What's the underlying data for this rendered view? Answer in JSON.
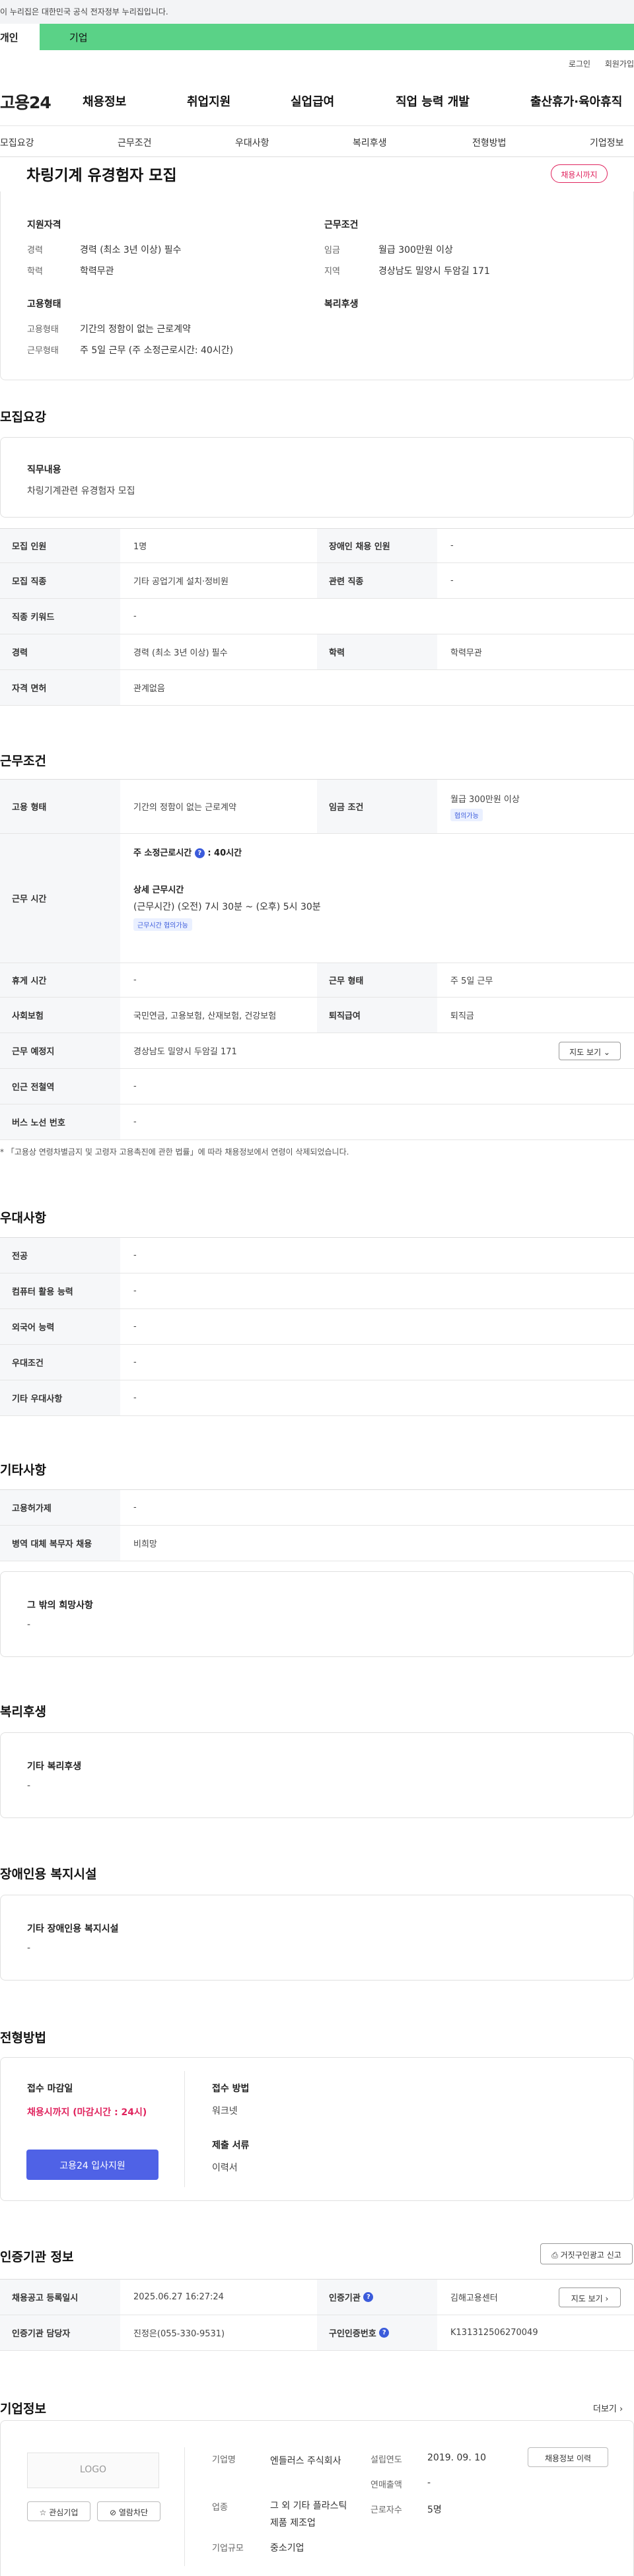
{
  "gov_bar": {
    "text": "이 누리집은 대한민국 공식 전자정부 누리집입니다."
  },
  "tabs": {
    "personal": "개인",
    "company": "기업"
  },
  "util": {
    "login": "로그인",
    "join": "회원가입"
  },
  "brand": {
    "name": "고용24"
  },
  "gnb": [
    "채용정보",
    "취업지원",
    "실업급여",
    "직업 능력 개발",
    "출산휴가·육아휴직"
  ],
  "subnav": [
    "모집요강",
    "근무조건",
    "우대사항",
    "복리후생",
    "전형방법",
    "기업정보"
  ],
  "job": {
    "title": "차링기계 유경험자 모집",
    "deadline_badge": "채용시까지"
  },
  "summary": {
    "qual_h": "지원자격",
    "career_k": "경력",
    "career_v": "경력 (최소 3년 이상) 필수",
    "edu_k": "학력",
    "edu_v": "학력무관",
    "cond_h": "근무조건",
    "wage_k": "임금",
    "wage_v": "월급 300만원 이상",
    "region_k": "지역",
    "region_v": "경상남도 밀양시 두암길 171",
    "emp_h": "고용형태",
    "emptype_k": "고용형태",
    "emptype_v": "기간의 정함이 없는 근로계약",
    "worktype_k": "근무형태",
    "worktype_v": "주 5일 근무 (주 소정근로시간: 40시간)",
    "welfare_h": "복리후생"
  },
  "recruit": {
    "section": "모집요강",
    "duty_h": "직무내용",
    "duty_v": "차링기계관련 유경험자 모집",
    "rows": [
      {
        "k1": "모집 인원",
        "v1": "1명",
        "k2": "장애인 채용 인원",
        "v2": "-"
      },
      {
        "k1": "모집 직종",
        "v1": "기타 공업기계 설치·정비원",
        "k2": "관련 직종",
        "v2": "-"
      },
      {
        "k1": "직종 키워드",
        "v1": "-"
      },
      {
        "k1": "경력",
        "v1": "경력 (최소 3년 이상) 필수",
        "k2": "학력",
        "v2": "학력무관"
      },
      {
        "k1": "자격 면허",
        "v1": "관계없음"
      }
    ]
  },
  "work": {
    "section": "근무조건",
    "emptype_k": "고용 형태",
    "emptype_v": "기간의 정함이 없는 근로계약",
    "wage_k": "임금 조건",
    "wage_v": "월급 300만원 이상",
    "wage_tag": "협의가능",
    "hours_k": "근무 시간",
    "hours_week": "주 소정근로시간",
    "hours_week_v": ": 40시간",
    "hours_detail_h": "상세 근무시간",
    "hours_detail_v": "(근무시간) (오전) 7시 30분 ~ (오후) 5시 30분",
    "hours_tag": "근무시간 협의가능",
    "rest_k": "휴게 시간",
    "rest_v": "-",
    "form_k": "근무 형태",
    "form_v": "주 5일 근무",
    "ins_k": "사회보험",
    "ins_v": "국민연금, 고용보험, 산재보험, 건강보험",
    "sev_k": "퇴직급여",
    "sev_v": "퇴직금",
    "place_k": "근무 예정지",
    "place_v": "경상남도 밀양시 두암길 171",
    "map_btn": "지도 보기",
    "subway_k": "인근 전철역",
    "subway_v": "-",
    "bus_k": "버스 노선 번호",
    "bus_v": "-",
    "note": "「고용상 연령차별금지 및 고령자 고용촉진에 관한 법률」에 따라 채용정보에서 연령이 삭제되었습니다."
  },
  "pref": {
    "section": "우대사항",
    "rows": [
      {
        "k": "전공",
        "v": "-"
      },
      {
        "k": "컴퓨터 활용 능력",
        "v": "-"
      },
      {
        "k": "외국어 능력",
        "v": "-"
      },
      {
        "k": "우대조건",
        "v": "-"
      },
      {
        "k": "기타 우대사항",
        "v": "-"
      }
    ]
  },
  "etc": {
    "section": "기타사항",
    "rows": [
      {
        "k": "고용허가제",
        "v": "-"
      },
      {
        "k": "병역 대체 복무자 채용",
        "v": "비희망"
      }
    ],
    "wish_h": "그 밖의 희망사항",
    "wish_v": "-"
  },
  "welfare": {
    "section": "복리후생",
    "h": "기타 복리후생",
    "v": "-"
  },
  "disab": {
    "section": "장애인용 복지시설",
    "h": "기타 장애인용 복지시설",
    "v": "-"
  },
  "selection": {
    "section": "전형방법",
    "deadline_h": "접수 마감일",
    "deadline_v": "채용시까지 (마감시간 : 24시)",
    "apply_btn": "고용24 입사지원",
    "method_h": "접수 방법",
    "method_v": "워크넷",
    "docs_h": "제출 서류",
    "docs_v": "이력서"
  },
  "cert": {
    "section": "인증기관 정보",
    "report_btn": "거짓구인광고 신고",
    "reg_k": "채용공고 등록일시",
    "reg_v": "2025.06.27 16:27:24",
    "org_k": "인증기관",
    "org_v": "김해고용센터",
    "map_btn": "지도 보기",
    "mgr_k": "인증기관 담당자",
    "mgr_v": "진정은(055-330-9531)",
    "id_k": "구인인증번호",
    "id_v": "K131312506270049"
  },
  "company": {
    "section": "기업정보",
    "more": "더보기",
    "logo": "LOGO",
    "fav_btn": "관심기업",
    "block_btn": "열람차단",
    "name_k": "기업명",
    "name_v": "엔들러스 주식회사",
    "ind_k": "업종",
    "ind_v": "그 외 기타 플라스틱 제품 제조업",
    "size_k": "기업규모",
    "size_v": "중소기업",
    "est_k": "설립연도",
    "est_v": "2019. 09. 10",
    "sales_k": "연매출액",
    "sales_v": "-",
    "emp_k": "근로자수",
    "emp_v": "5명",
    "hist_btn": "채용정보 이력"
  }
}
